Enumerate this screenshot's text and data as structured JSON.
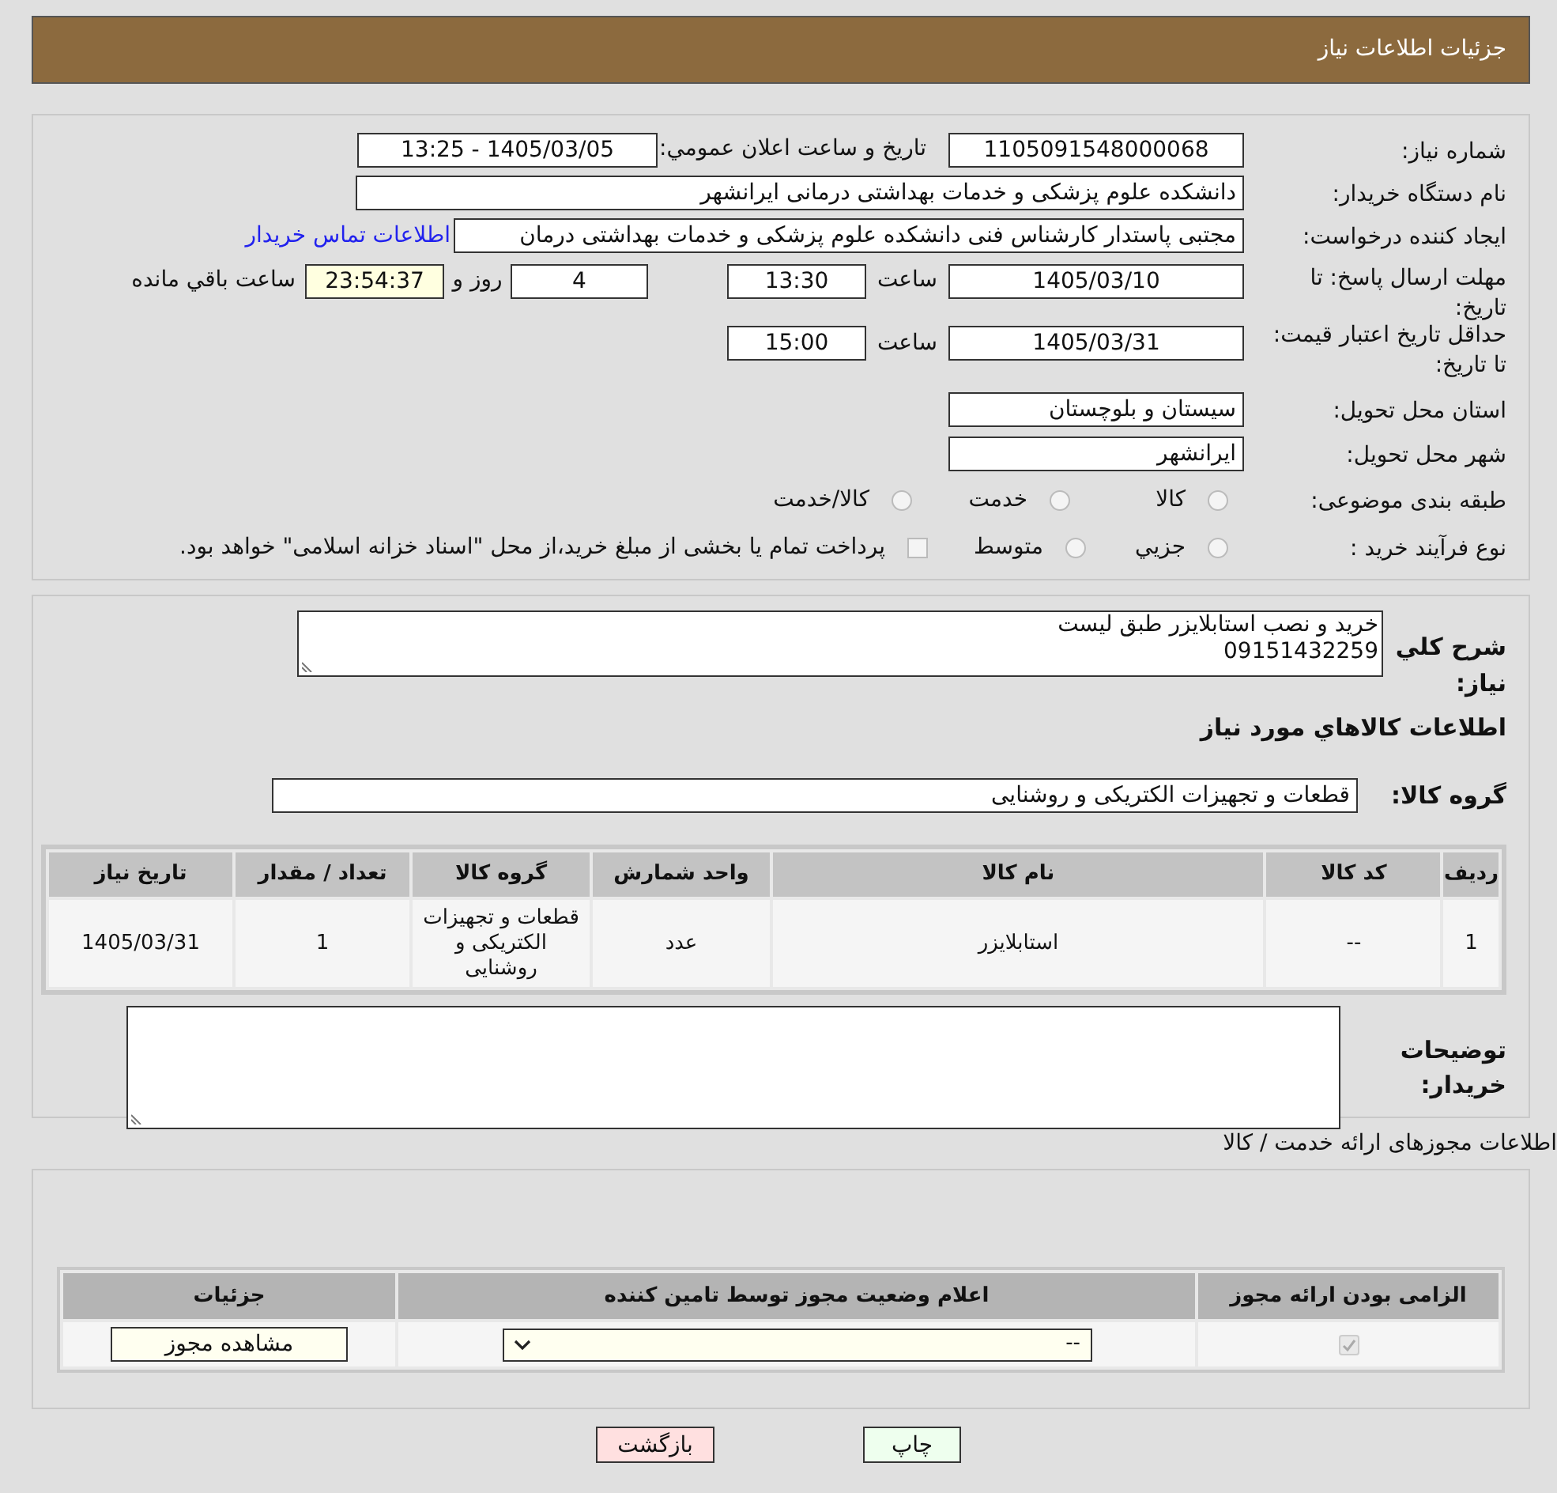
{
  "header": {
    "title": "جزئیات اطلاعات نیاز"
  },
  "details": {
    "need_number": {
      "label": "شماره نیاز:",
      "value": "1105091548000068"
    },
    "announce": {
      "label": "تاريخ و ساعت اعلان عمومي:",
      "value": "1405/03/05 - 13:25"
    },
    "buyer": {
      "label": "نام دستگاه خریدار:",
      "value": "دانشکده علوم پزشکی و خدمات بهداشتی درمانی ایرانشهر"
    },
    "requester": {
      "label": "ایجاد کننده درخواست:",
      "value": "مجتبی پاستدار کارشناس فنی دانشکده علوم پزشکی و خدمات بهداشتی درمان",
      "link": "اطلاعات تماس خریدار"
    },
    "response_deadline": {
      "label": "مهلت ارسال پاسخ: تا تاریخ:",
      "date": "1405/03/10",
      "time_label": "ساعت",
      "time": "13:30",
      "days": "4",
      "days_label": "روز و",
      "remaining": "23:54:37",
      "remaining_label": "ساعت باقي مانده"
    },
    "price_validity": {
      "label": "حداقل تاریخ اعتبار قیمت: تا تاریخ:",
      "date": "1405/03/31",
      "time_label": "ساعت",
      "time": "15:00"
    },
    "province": {
      "label": "استان محل تحویل:",
      "value": "سیستان و بلوچستان"
    },
    "city": {
      "label": "شهر محل تحویل:",
      "value": "ایرانشهر"
    },
    "category": {
      "label": "طبقه بندی موضوعی:",
      "options": [
        {
          "label": "كالا",
          "selected": false
        },
        {
          "label": "خدمت",
          "selected": false
        },
        {
          "label": "كالا/خدمت",
          "selected": false
        }
      ]
    },
    "purchase_type": {
      "label": "نوع فرآیند خرید :",
      "options": [
        {
          "label": "جزيي",
          "selected": false
        },
        {
          "label": "متوسط",
          "selected": false
        }
      ],
      "payment": {
        "label": "پرداخت تمام یا بخشی از مبلغ خرید،از محل \"اسناد خزانه اسلامی\" خواهد بود.",
        "checked": false
      }
    }
  },
  "goods": {
    "description_label": "شرح كلي نياز:",
    "description": "خرید و نصب استابلایزر طبق لیست\n09151432259",
    "heading": "اطلاعات كالاهاي مورد نياز",
    "group_label": "گروه کالا:",
    "group": "قطعات و تجهیزات الکتریکی و روشنایی",
    "table": {
      "columns": [
        "ردیف",
        "کد کالا",
        "نام کالا",
        "واحد شمارش",
        "گروه کالا",
        "تعداد / مقدار",
        "تاریخ نیاز"
      ],
      "rows": [
        [
          "1",
          "--",
          "استابلایزر",
          "عدد",
          "قطعات و تجهیزات الکتریکی و روشنایی",
          "1",
          "1405/03/31"
        ]
      ]
    },
    "notes_label": "توضیحات خریدار:"
  },
  "licenses": {
    "title": "اطلاعات مجوزهای ارائه خدمت / کالا",
    "columns": [
      "الزامی بودن ارائه مجوز",
      "اعلام وضعیت مجوز توسط تامین کننده",
      "جزئیات"
    ],
    "rows": [
      {
        "required": true,
        "status": "--",
        "details_button": "مشاهده مجوز"
      }
    ]
  },
  "buttons": [
    {
      "label": "چاپ",
      "kind": "print"
    },
    {
      "label": "بازگشت",
      "kind": "back"
    }
  ]
}
